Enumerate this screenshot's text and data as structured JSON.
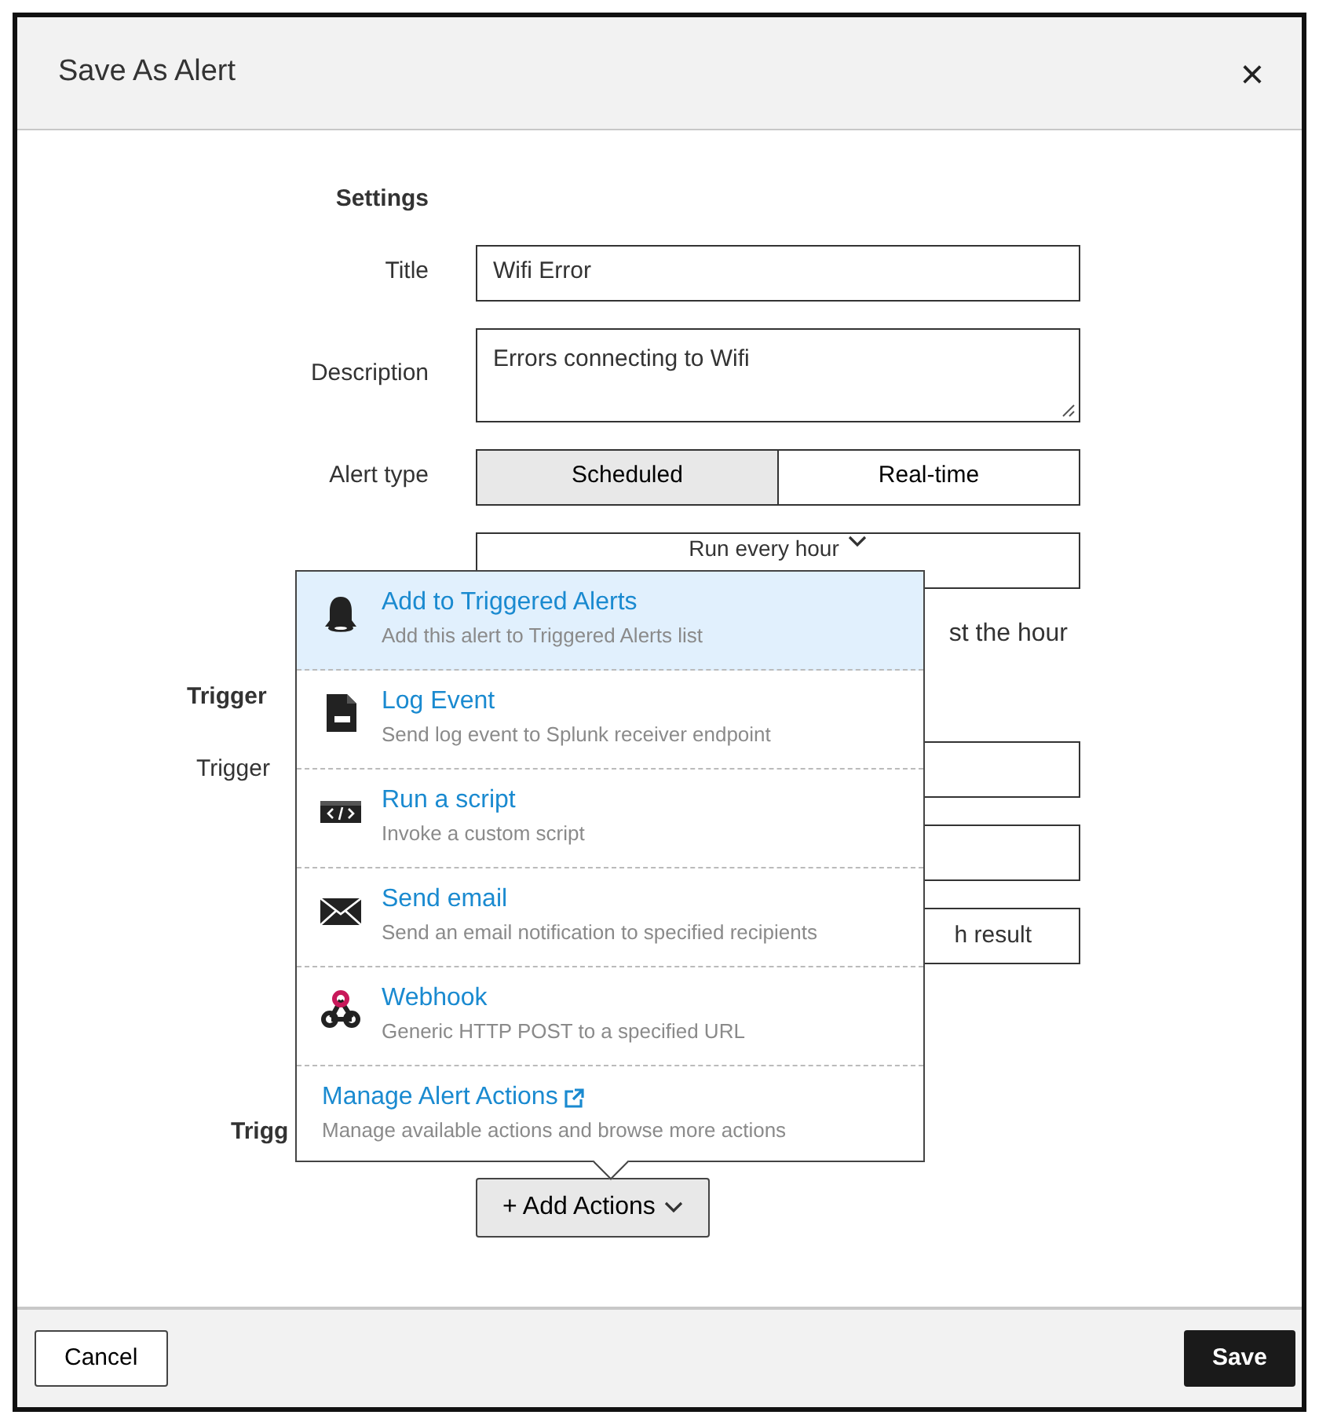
{
  "dialog": {
    "title": "Save As Alert",
    "close": "×"
  },
  "form": [
    {
      "kind": "heading",
      "label": "Settings"
    },
    {
      "kind": "input",
      "label": "Title",
      "value": "Wifi Error"
    },
    {
      "kind": "textarea",
      "label": "Description",
      "value": "Errors connecting to Wifi"
    },
    {
      "kind": "toggle",
      "label": "Alert type",
      "options": [
        {
          "label": "Scheduled",
          "selected": true
        },
        {
          "label": "Real-time",
          "selected": false
        }
      ]
    },
    {
      "kind": "select",
      "value": "Run every hour"
    },
    {
      "kind": "note",
      "value": "st the hour"
    },
    {
      "kind": "heading",
      "label": "Trigger"
    },
    {
      "kind": "input",
      "label": "Trigger"
    },
    {
      "kind": "input"
    },
    {
      "kind": "input",
      "value": "h result"
    },
    {
      "kind": "gap"
    },
    {
      "kind": "heading",
      "label": "Trigg"
    }
  ],
  "add_actions": {
    "label": "+ Add Actions"
  },
  "actions_menu": [
    {
      "title": "Add to Triggered Alerts",
      "description": "Add this alert to Triggered Alerts list",
      "selected": true
    },
    {
      "title": "Log Event",
      "description": "Send log event to Splunk receiver endpoint",
      "selected": false
    },
    {
      "title": "Run a script",
      "description": "Invoke a custom script",
      "selected": false
    },
    {
      "title": "Send email",
      "description": "Send an email notification to specified recipients",
      "selected": false
    },
    {
      "title": "Webhook",
      "description": "Generic HTTP POST to a specified URL",
      "selected": false
    }
  ],
  "manage": {
    "title": "Manage Alert Actions",
    "description": "Manage available actions and browse more actions"
  },
  "footer": {
    "cancel": "Cancel",
    "save": "Save"
  }
}
